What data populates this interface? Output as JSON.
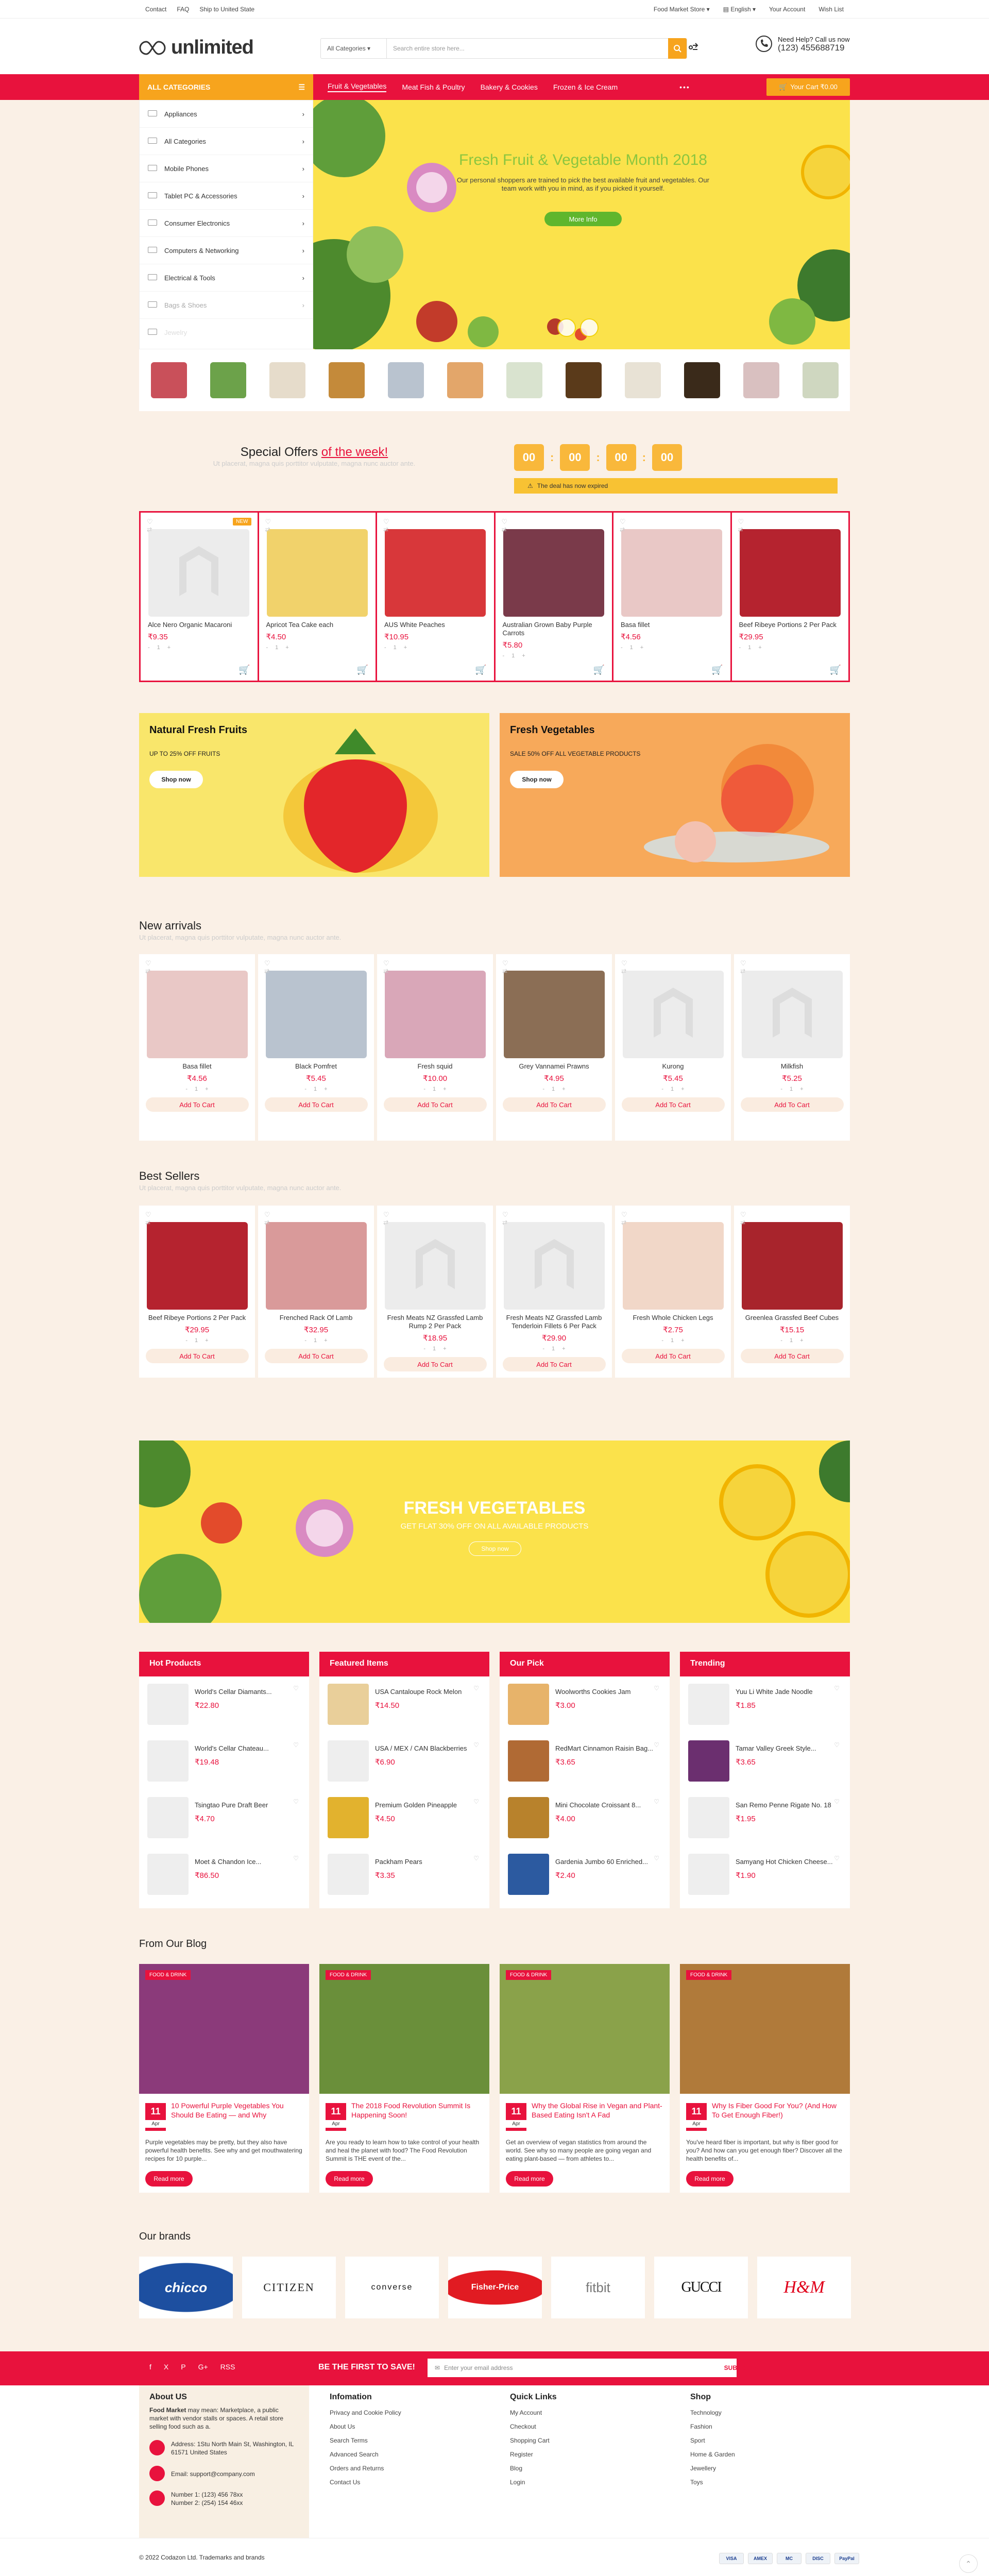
{
  "topbar": {
    "links": [
      "Contact",
      "FAQ",
      "Ship to United State"
    ],
    "store": "Food Market Store",
    "language": "English",
    "account": "Your Account",
    "wishlist": "Wish List"
  },
  "header": {
    "logo": "unlimited",
    "search_category": "All Categories",
    "search_placeholder": "Search entire store here...",
    "help_title": "Need Help? Call us now",
    "phone": "(123) 455688719"
  },
  "nav": {
    "all_categories": "ALL CATEGORIES",
    "items": [
      "Fruit & Vegetables",
      "Meat Fish & Poultry",
      "Bakery & Cookies",
      "Frozen & Ice Cream"
    ],
    "more": "•••",
    "cart": "Your Cart ₹0.00"
  },
  "sidebar": [
    "Appliances",
    "All Categories",
    "Mobile Phones",
    "Tablet PC & Accessories",
    "Consumer Electronics",
    "Computers & Networking",
    "Electrical & Tools",
    "Bags & Shoes",
    "Jewelry"
  ],
  "hero": {
    "title": "Fresh Fruit & Vegetable Month 2018",
    "text": "Our personal shoppers are trained to pick the best available fruit and vegetables. Our team work with you in mind, as if you picked it yourself.",
    "button": "More Info"
  },
  "offers": {
    "title_a": "Special Offers",
    "title_b": "of the week!",
    "subtitle": "Ut placerat, magna quis porttitor vulputate, magna nunc auctor ante.",
    "timer": [
      "00",
      "00",
      "00",
      "00"
    ],
    "expired": "The deal has now expired"
  },
  "special_products": [
    {
      "name": "Alce Nero Organic Macaroni",
      "price": "₹9.35",
      "badge": "NEW",
      "color": "#ececec"
    },
    {
      "name": "Apricot Tea Cake each",
      "price": "₹4.50",
      "color": "#f1d26b"
    },
    {
      "name": "AUS White Peaches",
      "price": "₹10.95",
      "color": "#d8373a"
    },
    {
      "name": "Australian Grown Baby Purple Carrots",
      "price": "₹5.80",
      "color": "#7a3a4a"
    },
    {
      "name": "Basa fillet",
      "price": "₹4.56",
      "color": "#e9c8c6"
    },
    {
      "name": "Beef Ribeye Portions 2 Per Pack",
      "price": "₹29.95",
      "color": "#b5232f"
    }
  ],
  "banners": [
    {
      "title": "Natural Fresh Fruits",
      "text": "UP TO 25% OFF FRUITS",
      "button": "Shop now"
    },
    {
      "title": "Fresh Vegetables",
      "text": "SALE 50% OFF ALL VEGETABLE PRODUCTS",
      "button": "Shop now"
    }
  ],
  "new_arrivals": {
    "title": "New arrivals",
    "subtitle": "Ut placerat, magna quis porttitor vulputate, magna nunc auctor ante.",
    "items": [
      {
        "name": "Basa fillet",
        "price": "₹4.56",
        "color": "#e9c8c6"
      },
      {
        "name": "Black Pomfret",
        "price": "₹5.45",
        "color": "#b9c3cf"
      },
      {
        "name": "Fresh squid",
        "price": "₹10.00",
        "color": "#d9a7b8"
      },
      {
        "name": "Grey Vannamei Prawns",
        "price": "₹4.95",
        "color": "#8b6e55"
      },
      {
        "name": "Kurong",
        "price": "₹5.45",
        "color": "#ececec"
      },
      {
        "name": "Milkfish",
        "price": "₹5.25",
        "color": "#ececec"
      }
    ]
  },
  "best_sellers": {
    "title": "Best Sellers",
    "subtitle": "Ut placerat, magna quis porttitor vulputate, magna nunc auctor ante.",
    "items": [
      {
        "name": "Beef Ribeye Portions 2 Per Pack",
        "price": "₹29.95",
        "color": "#b5232f"
      },
      {
        "name": "Frenched Rack Of Lamb",
        "price": "₹32.95",
        "color": "#d99a9a"
      },
      {
        "name": "Fresh Meats NZ Grassfed Lamb Rump 2 Per Pack",
        "price": "₹18.95",
        "color": "#ececec"
      },
      {
        "name": "Fresh Meats NZ Grassfed Lamb Tenderloin Fillets 6 Per Pack",
        "price": "₹29.90",
        "color": "#ececec"
      },
      {
        "name": "Fresh Whole Chicken Legs",
        "price": "₹2.75",
        "color": "#f1d7c8"
      },
      {
        "name": "Greenlea Grassfed Beef Cubes",
        "price": "₹15.15",
        "color": "#a8242c"
      }
    ]
  },
  "add_to_cart": "Add To Cart",
  "qty": [
    "-",
    "1",
    "+"
  ],
  "big_banner": {
    "title": "FRESH VEGETABLES",
    "text": "GET FLAT 30% OFF ON ALL AVAILABLE PRODUCTS",
    "button": "Shop now"
  },
  "columns": [
    {
      "title": "Hot Products",
      "items": [
        {
          "name": "World's Cellar Diamants...",
          "price": "₹22.80",
          "color": "#eee"
        },
        {
          "name": "World's Cellar Chateau...",
          "price": "₹19.48",
          "color": "#eee"
        },
        {
          "name": "Tsingtao Pure Draft Beer",
          "price": "₹4.70",
          "color": "#eee"
        },
        {
          "name": "Moet & Chandon Ice...",
          "price": "₹86.50",
          "color": "#eee"
        }
      ]
    },
    {
      "title": "Featured Items",
      "items": [
        {
          "name": "USA Cantaloupe Rock Melon",
          "price": "₹14.50",
          "color": "#e9cf9a"
        },
        {
          "name": "USA / MEX / CAN Blackberries",
          "price": "₹6.90",
          "color": "#eee"
        },
        {
          "name": "Premium Golden Pineapple",
          "price": "₹4.50",
          "color": "#e2b22e"
        },
        {
          "name": "Packham Pears",
          "price": "₹3.35",
          "color": "#eee"
        }
      ]
    },
    {
      "title": "Our Pick",
      "items": [
        {
          "name": "Woolworths Cookies Jam",
          "price": "₹3.00",
          "color": "#e7b36a"
        },
        {
          "name": "RedMart Cinnamon Raisin Bag...",
          "price": "₹3.65",
          "color": "#b06a34"
        },
        {
          "name": "Mini Chocolate Croissant 8...",
          "price": "₹4.00",
          "color": "#b8822c"
        },
        {
          "name": "Gardenia Jumbo 60 Enriched...",
          "price": "₹2.40",
          "color": "#2c5aa0"
        }
      ]
    },
    {
      "title": "Trending",
      "items": [
        {
          "name": "Yuu Li White Jade Noodle",
          "price": "₹1.85",
          "color": "#eee"
        },
        {
          "name": "Tamar Valley Greek Style...",
          "price": "₹3.65",
          "color": "#6b2f6f"
        },
        {
          "name": "San Remo Penne Rigate No. 18",
          "price": "₹1.95",
          "color": "#eee"
        },
        {
          "name": "Samyang Hot Chicken Cheese...",
          "price": "₹1.90",
          "color": "#eee"
        }
      ]
    }
  ],
  "blog": {
    "title": "From Our Blog",
    "tag": "FOOD & DRINK",
    "day": "11",
    "month": "Apr",
    "read_more": "Read more",
    "posts": [
      {
        "title": "10 Powerful Purple Vegetables You Should Be Eating — and Why",
        "excerpt": "Purple vegetables may be pretty, but they also have powerful health benefits. See why and get mouthwatering recipes for 10 purple...",
        "color": "#8b3a7a"
      },
      {
        "title": "The 2018 Food Revolution Summit Is Happening Soon!",
        "excerpt": "Are you ready to learn how to take control of your health and heal the planet with food? The Food Revolution Summit is THE event of the...",
        "color": "#6a8f3a"
      },
      {
        "title": "Why the Global Rise in Vegan and Plant-Based Eating Isn't A Fad",
        "excerpt": "Get an overview of vegan statistics from around the world. See why so many people are going vegan and eating plant-based — from athletes to...",
        "color": "#8aa24a"
      },
      {
        "title": "Why Is Fiber Good For You? (And How To Get Enough Fiber!)",
        "excerpt": "You've heard fiber is important, but why is fiber good for you? And how can you get enough fiber? Discover all the health benefits of...",
        "color": "#b07a3a"
      }
    ]
  },
  "brands": {
    "title": "Our brands",
    "items": [
      "chicco",
      "CITIZEN",
      "converse",
      "Fisher-Price",
      "fitbit",
      "GUCCI",
      "H&M"
    ]
  },
  "newsletter": {
    "social": [
      "f",
      "X",
      "P",
      "G+",
      "RSS"
    ],
    "title": "BE THE FIRST TO SAVE!",
    "placeholder": "Enter your email address",
    "button": "SUBSCRIBE"
  },
  "footer": {
    "about_title": "About US",
    "about_strong": "Food Market",
    "about_text": " may mean: Marketplace, a public market with vendor stalls or spaces. A retail store selling food such as a.",
    "address": "Address: 1Stu North Main St, Washington, IL 61571 United States",
    "email": "Email: support@company.com",
    "phones": [
      "Number 1: (123) 456 78xx",
      "Number 2: (254) 154 46xx"
    ],
    "cols": [
      {
        "title": "Infomation",
        "links": [
          "Privacy and Cookie Policy",
          "About Us",
          "Search Terms",
          "Advanced Search",
          "Orders and Returns",
          "Contact Us"
        ]
      },
      {
        "title": "Quick Links",
        "links": [
          "My Account",
          "Checkout",
          "Shopping Cart",
          "Register",
          "Blog",
          "Login"
        ]
      },
      {
        "title": "Shop",
        "links": [
          "Technology",
          "Fashion",
          "Sport",
          "Home & Garden",
          "Jewellery",
          "Toys"
        ]
      }
    ],
    "copyright": "© 2022 Codazon Ltd. Trademarks and brands",
    "payments": [
      "VISA",
      "AMEX",
      "MC",
      "DISC",
      "PayPal"
    ]
  }
}
